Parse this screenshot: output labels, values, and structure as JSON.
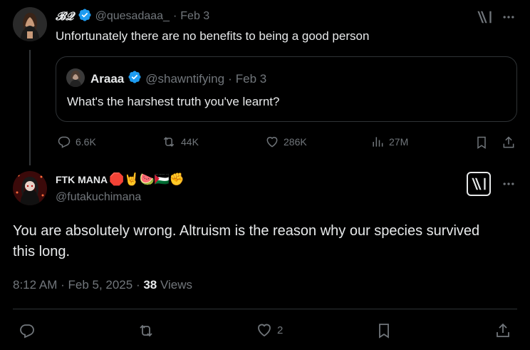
{
  "original_tweet": {
    "display_name": "𝓑𝓠",
    "handle": "@quesadaaa_",
    "date": "Feb 3",
    "text": "Unfortunately there are no benefits to being a good person",
    "stats": {
      "replies": "6.6K",
      "reposts": "44K",
      "likes": "286K",
      "views": "27M"
    }
  },
  "quoted_tweet": {
    "display_name": "Araaa",
    "handle": "@shawntifying",
    "date": "Feb 3",
    "text": "What's the harshest truth you've learnt?"
  },
  "reply_tweet": {
    "display_name": "FTK MANA",
    "emojis": "🛑🤘🍉🇵🇸✊",
    "handle": "@futakuchimana",
    "text": "You are absolutely wrong. Altruism is the reason why our species survived this long.",
    "time": "8:12 AM · Feb 5, 2025 · ",
    "views_count": "38",
    "views_label": " Views",
    "likes": "2"
  },
  "colors": {
    "background": "#000000",
    "text": "#e7e9ea",
    "muted": "#71767b",
    "verified": "#1d9bf0",
    "border": "#2f3336"
  },
  "icons": [
    "grok-icon",
    "more-icon",
    "reply-icon",
    "repost-icon",
    "like-icon",
    "views-icon",
    "bookmark-icon",
    "share-icon",
    "verified-icon"
  ]
}
